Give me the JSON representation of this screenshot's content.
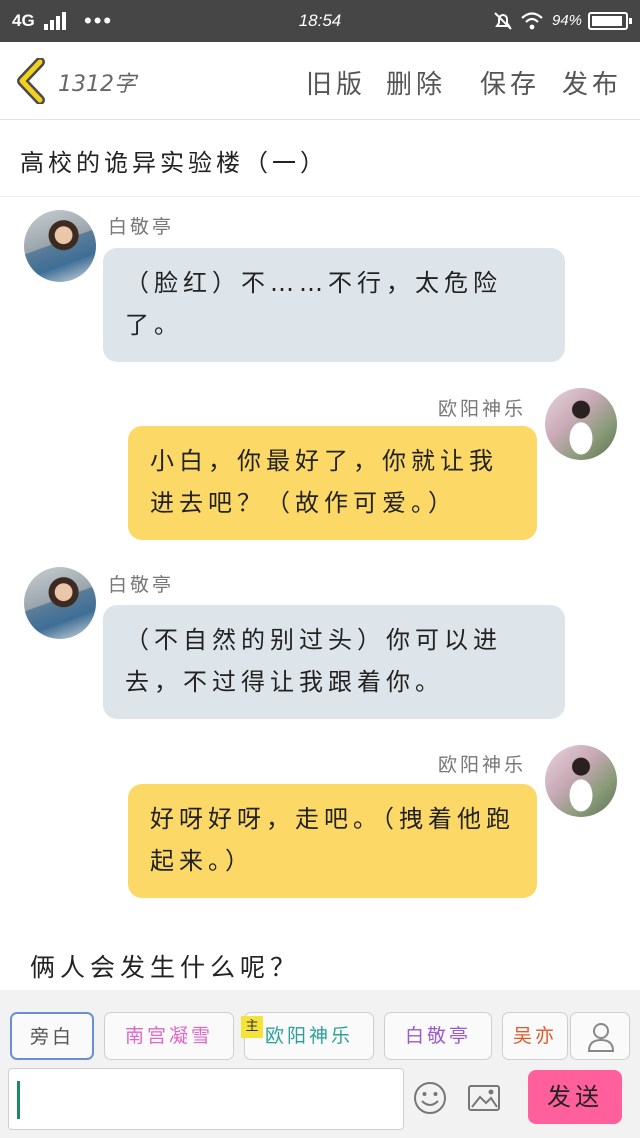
{
  "status_bar": {
    "network": "4G",
    "time": "18:54",
    "battery": "94%",
    "battery_level": 0.94
  },
  "toolbar": {
    "word_count": "1312字",
    "old_version": "旧版",
    "delete": "删除",
    "save": "保存",
    "publish": "发布"
  },
  "story": {
    "title": "高校的诡异实验楼（一）"
  },
  "messages": [
    {
      "speaker": "白敬亭",
      "side": "left",
      "text": "（脸红）不……不行，太危险了。"
    },
    {
      "speaker": "欧阳神乐",
      "side": "right",
      "text": "小白，你最好了，你就让我进去吧？（故作可爱。）"
    },
    {
      "speaker": "白敬亭",
      "side": "left",
      "text": "（不自然的别过头）你可以进去，不过得让我跟着你。"
    },
    {
      "speaker": "欧阳神乐",
      "side": "right",
      "text": "好呀好呀，走吧。（拽着他跑起来。）"
    }
  ],
  "narration": "俩人会发生什么呢？",
  "characters": {
    "items": [
      {
        "label": "旁白",
        "color": "#555555"
      },
      {
        "label": "南宫凝雪",
        "color": "#e066c8"
      },
      {
        "label": "欧阳神乐",
        "color": "#2aa198"
      },
      {
        "label": "白敬亭",
        "color": "#9b59d0"
      },
      {
        "label": "吴亦",
        "color": "#e2572c"
      }
    ],
    "main_badge": "主"
  },
  "composer": {
    "send_label": "发送"
  },
  "colors": {
    "bubble_left": "#dde5ea",
    "bubble_right": "#fcd866",
    "send": "#ff5f9a",
    "back_arrow": "#f2d21c"
  }
}
